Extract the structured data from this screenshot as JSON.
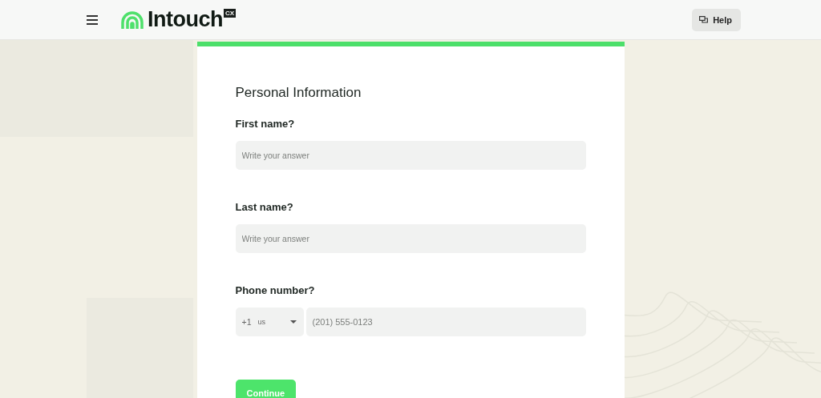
{
  "header": {
    "logo": {
      "name": "Intouch",
      "badge": "CX"
    },
    "help_button": "Help"
  },
  "form": {
    "progress": {
      "level": 1
    },
    "title": "Personal Information",
    "questions": [
      {
        "kind": "text",
        "label": "First name?",
        "placeholder": "Write your answer"
      },
      {
        "kind": "text",
        "label": "Last name?",
        "placeholder": "Write your answer"
      },
      {
        "kind": "phone",
        "label": "Phone number?",
        "dial_code": "+1",
        "country": "us",
        "placeholder": "(201) 555-0123"
      }
    ],
    "submit_button": "Continue"
  }
}
